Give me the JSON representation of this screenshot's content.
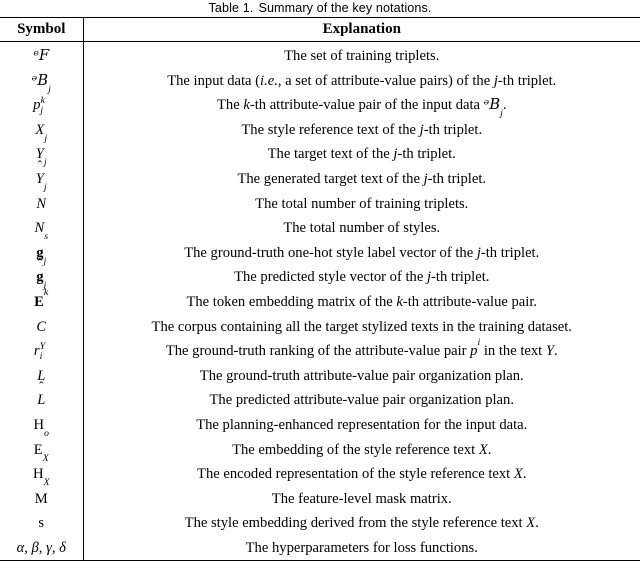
{
  "caption": {
    "label": "Table 1.",
    "text": "Summary of the key notations."
  },
  "table": {
    "headers": {
      "symbol": "Symbol",
      "explanation": "Explanation"
    },
    "rows": [
      {
        "symbol_plain": "D",
        "explanation": "The set of training triplets."
      },
      {
        "symbol_plain": "P_j",
        "explanation": "The input data (i.e., a set of attribute-value pairs) of the j-th triplet."
      },
      {
        "symbol_plain": "p_j^k",
        "explanation": "The k-th attribute-value pair of the input data P_j."
      },
      {
        "symbol_plain": "X_j",
        "explanation": "The style reference text of the j-th triplet."
      },
      {
        "symbol_plain": "Y_j",
        "explanation": "The target text of the j-th triplet."
      },
      {
        "symbol_plain": "Y-hat_j",
        "explanation": "The generated target text of the j-th triplet."
      },
      {
        "symbol_plain": "N",
        "explanation": "The total number of training triplets."
      },
      {
        "symbol_plain": "N_s",
        "explanation": "The total number of styles."
      },
      {
        "symbol_plain": "g_j",
        "explanation": "The ground-truth one-hot style label vector of the j-th triplet."
      },
      {
        "symbol_plain": "g-hat_j",
        "explanation": "The predicted style vector of the j-th triplet."
      },
      {
        "symbol_plain": "E^k",
        "explanation": "The token embedding matrix of the k-th attribute-value pair."
      },
      {
        "symbol_plain": "C",
        "explanation": "The corpus containing all the target stylized texts in the training dataset."
      },
      {
        "symbol_plain": "r_i^Y",
        "explanation": "The ground-truth ranking of the attribute-value pair p^i in the text Y."
      },
      {
        "symbol_plain": "L",
        "explanation": "The ground-truth attribute-value pair organization plan."
      },
      {
        "symbol_plain": "L-hat",
        "explanation": "The predicted attribute-value pair organization plan."
      },
      {
        "symbol_plain": "H_o",
        "explanation": "The planning-enhanced representation for the input data."
      },
      {
        "symbol_plain": "E_X",
        "explanation": "The embedding of the style reference text X."
      },
      {
        "symbol_plain": "H_X",
        "explanation": "The encoded representation of the style reference text X."
      },
      {
        "symbol_plain": "M",
        "explanation": "The feature-level mask matrix."
      },
      {
        "symbol_plain": "s",
        "explanation": "The style embedding derived from the style reference text X."
      },
      {
        "symbol_plain": "alpha, beta, gamma, delta",
        "explanation": "The hyperparameters for loss functions."
      }
    ],
    "explanation_parts": {
      "r0": [
        "The set of training triplets."
      ],
      "r1_a": "The input data (",
      "r1_ie": "i.e.",
      "r1_b": ", a set of attribute-value pairs) of the ",
      "r1_j": "j",
      "r1_c": "-th triplet.",
      "r2_a": "The ",
      "r2_k": "k",
      "r2_b": "-th attribute-value pair of the input data ",
      "r2_c": ".",
      "r3_a": "The style reference text of the ",
      "r3_b": "-th triplet.",
      "r4_a": "The target text of the ",
      "r4_b": "-th triplet.",
      "r5_a": "The generated target text of the ",
      "r5_b": "-th triplet.",
      "r6": "The total number of training triplets.",
      "r7": "The total number of styles.",
      "r8_a": "The ground-truth one-hot style label vector of the ",
      "r8_b": "-th triplet.",
      "r9_a": "The predicted style vector of the ",
      "r9_b": "-th triplet.",
      "r10_a": "The token embedding matrix of the ",
      "r10_k": "k",
      "r10_b": "-th attribute-value pair.",
      "r11": "The corpus containing all the target stylized texts in the training dataset.",
      "r12_a": "The ground-truth ranking of the attribute-value pair ",
      "r12_b": " in the text ",
      "r12_c": ".",
      "r13": "The ground-truth attribute-value pair organization plan.",
      "r14": "The predicted attribute-value pair organization plan.",
      "r15": "The planning-enhanced representation for the input data.",
      "r16_a": "The embedding of the style reference text ",
      "r16_b": ".",
      "r17_a": "The encoded representation of the style reference text ",
      "r17_b": ".",
      "r18": "The feature-level mask matrix.",
      "r19_a": "The style embedding derived from the style reference text ",
      "r19_b": ".",
      "r20": "The hyperparameters for loss functions."
    },
    "symbol_glyphs": {
      "D": "ᵉF",
      "P": "ᵊB",
      "p": "p",
      "X": "X",
      "Y": "Y",
      "N": "N",
      "g": "g",
      "E": "E",
      "C": "C",
      "r": "r",
      "L": "L",
      "H": "H",
      "M": "M",
      "s": "s",
      "j": "j",
      "k": "k",
      "i": "i",
      "s_sub": "s",
      "o_sub": "o",
      "X_sub": "X",
      "Y_sup": "Y",
      "greek": "α, β, γ, δ"
    }
  }
}
